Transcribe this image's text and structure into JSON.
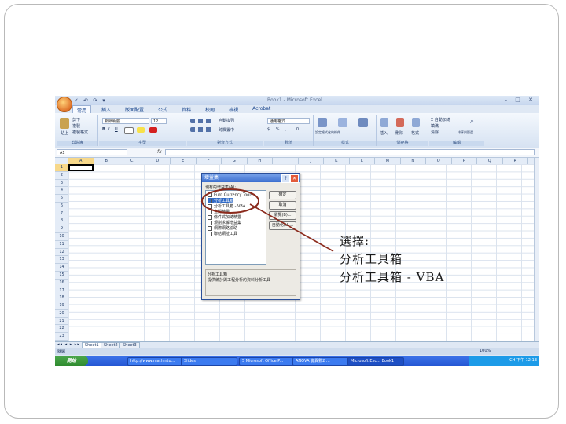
{
  "excel": {
    "window_title": "Book1 - Microsoft Excel",
    "quick_access": "✓ ↶ ↷ ▾",
    "window_controls": "– □ ✕",
    "tabs": [
      "常用",
      "插入",
      "版面配置",
      "公式",
      "資料",
      "校閱",
      "檢視",
      "Acrobat"
    ],
    "ribbon": {
      "groups": [
        "剪貼簿",
        "字型",
        "對齊方式",
        "數值",
        "樣式",
        "儲存格",
        "編輯"
      ],
      "font_name": "新細明體",
      "font_size": "12",
      "number_format": "通用格式",
      "paste_label": "貼上",
      "cut_label": "剪下",
      "copy_label": "複製",
      "format_painter_label": "複製格式",
      "wrap_label": "自動換列",
      "merge_label": "跨欄置中",
      "cond_format_label": "設定格式化的條件",
      "table_format_label": "格式化為表格",
      "cell_styles_label": "儲存格樣式",
      "insert_label": "插入",
      "delete_label": "刪除",
      "format_label": "格式",
      "sum_label": "Σ 自動加總",
      "fill_label": "填滿",
      "clear_label": "清除",
      "sort_label": "排序與篩選",
      "find_label": "尋找與選取"
    },
    "name_box": "A1",
    "fx": "fx",
    "columns": [
      "A",
      "B",
      "C",
      "D",
      "E",
      "F",
      "G",
      "H",
      "I",
      "J",
      "K",
      "L",
      "M",
      "N",
      "O",
      "P",
      "Q",
      "R"
    ],
    "rows": [
      "1",
      "2",
      "3",
      "4",
      "5",
      "6",
      "7",
      "8",
      "9",
      "10",
      "11",
      "12",
      "13",
      "14",
      "15",
      "16",
      "17",
      "18",
      "19",
      "20",
      "21",
      "22",
      "23"
    ],
    "sheet_tabs": [
      "Sheet1",
      "Sheet2",
      "Sheet3"
    ],
    "status_left": "就緒",
    "zoom": "100%"
  },
  "dialog": {
    "title": "增益集",
    "help": "?",
    "close": "✕",
    "caption": "現有的增益集(A):",
    "items": [
      "Euro Currency Tools",
      "分析工具箱",
      "分析工具箱 - VBA",
      "查閱精靈",
      "條件式加總精靈",
      "規劃求解增益集",
      "網際網路協助",
      "聯結網址工具"
    ],
    "buttons": [
      "確定",
      "取消",
      "瀏覽(B)...",
      "自動化(U)..."
    ],
    "desc_title": "分析工具箱",
    "desc_text": "提供統計與工程分析的資料分析工具"
  },
  "taskbar": {
    "start": "開始",
    "items": [
      "http://www.math.ntu...",
      "Slides",
      "5 Microsoft Office P...",
      "ANOVA 變異數2 ...",
      "Microsoft Exc... Book1"
    ],
    "clock": "CH 下午 12:13"
  },
  "annotation": {
    "line1": "選擇:",
    "line2": "分析工具箱",
    "line3": "分析工具箱 - VBA"
  }
}
